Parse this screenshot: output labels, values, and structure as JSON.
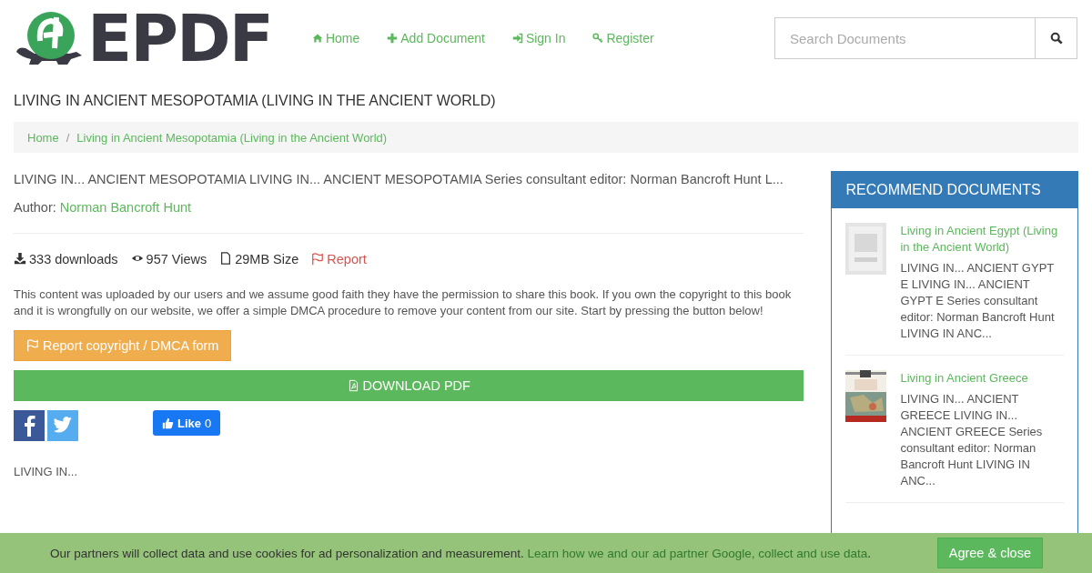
{
  "logo": {
    "text": "EPDF"
  },
  "nav": [
    {
      "kind": "home",
      "label": "Home"
    },
    {
      "kind": "plus",
      "label": "Add Document"
    },
    {
      "kind": "signin",
      "label": "Sign In"
    },
    {
      "kind": "key",
      "label": "Register"
    }
  ],
  "search": {
    "placeholder": "Search Documents"
  },
  "title": "LIVING IN ANCIENT MESOPOTAMIA (LIVING IN THE ANCIENT WORLD)",
  "breadcrumb": {
    "separator": "/",
    "items": [
      "Home",
      "Living in Ancient Mesopotamia (Living in the Ancient World)"
    ]
  },
  "description": "LIVING IN... ANCIENT MESOPOTAMIA LIVING IN... ANCIENT MESOPOTAMIA Series consultant editor: Norman Bancroft Hunt L...",
  "author": {
    "label": "Author:",
    "name": "Norman Bancroft Hunt"
  },
  "stats": [
    {
      "kind": "download",
      "text": "333 downloads"
    },
    {
      "kind": "eye",
      "text": "957 Views"
    },
    {
      "kind": "file",
      "text": "29MB Size"
    },
    {
      "kind": "report",
      "text": "Report"
    }
  ],
  "notice": "This content was uploaded by our users and we assume good faith they have the permission to share this book. If you own the copyright to this book and it is wrongfully on our website, we offer a simple DMCA procedure to remove your content from our site. Start by pressing the button below!",
  "dmca_button": "Report copyright / DMCA form",
  "download_button": "DOWNLOAD PDF",
  "like_button": {
    "label": "Like",
    "count": "0"
  },
  "content_start": "LIVING IN...",
  "sidebar": {
    "title": "RECOMMEND DOCUMENTS",
    "items": [
      {
        "title": "Living in Ancient Egypt (Living in the Ancient World)",
        "excerpt": "LIVING IN... ANCIENT GYPT E LIVING IN... ANCIENT GYPT E Series consultant editor: Norman Bancroft Hunt LIVING IN ANC...",
        "kind": "picture"
      },
      {
        "title": "Living in Ancient Greece",
        "excerpt": "LIVING IN... ANCIENT GREECE LIVING IN... ANCIENT GREECE Series consultant editor: Norman Bancroft Hunt LIVING IN ANC...",
        "kind": "picture"
      }
    ]
  },
  "cookie": {
    "text": "Our partners will collect data and use cookies for ad personalization and measurement.",
    "link": "Learn how we and our ad partner Google, collect and use data",
    "end": ".",
    "button": "Agree & close"
  }
}
